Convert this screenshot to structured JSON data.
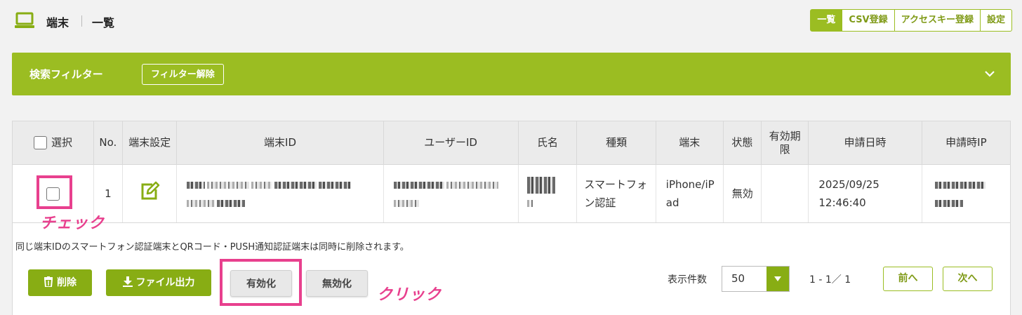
{
  "header": {
    "icon": "laptop-icon",
    "title": "端末",
    "subtitle": "一覧",
    "tabs": [
      {
        "label": "一覧",
        "active": true
      },
      {
        "label": "CSV登録",
        "active": false
      },
      {
        "label": "アクセスキー登録",
        "active": false
      },
      {
        "label": "設定",
        "active": false
      }
    ]
  },
  "filter": {
    "title": "検索フィルター",
    "clear_label": "フィルター解除",
    "toggle_icon": "chevron-down-icon"
  },
  "table": {
    "columns": [
      "選択",
      "No.",
      "端末設定",
      "端末ID",
      "ユーザーID",
      "氏名",
      "種類",
      "端末",
      "状態",
      "有効期限",
      "申請日時",
      "申請時IP"
    ],
    "rows": [
      {
        "no": "1",
        "edit_icon": "edit-icon",
        "type": "スマートフォン認証",
        "device": "iPhone/iPad",
        "status": "無効",
        "expiry": "",
        "requested_at": "2025/09/25 12:46:40"
      }
    ]
  },
  "note": "同じ端末IDのスマートフォン認証端末とQRコード・PUSH通知認証端末は同時に削除されます。",
  "actions": {
    "delete": "削除",
    "export": "ファイル出力",
    "enable": "有効化",
    "disable": "無効化"
  },
  "pagination": {
    "per_page_label": "表示件数",
    "per_page_value": "50",
    "info": "1 - 1／ 1",
    "prev": "前へ",
    "next": "次へ"
  },
  "annotations": {
    "check": "チェック",
    "click": "クリック"
  },
  "colors": {
    "accent": "#9bbd22",
    "highlight": "#e8408e"
  }
}
